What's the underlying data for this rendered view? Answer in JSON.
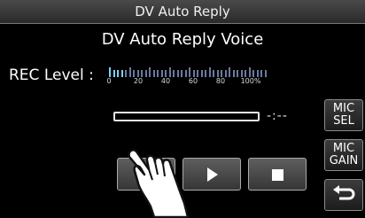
{
  "window": {
    "title": "DV Auto Reply"
  },
  "main": {
    "heading": "DV Auto Reply Voice",
    "rec_level_label": "REC Level :",
    "meter": {
      "scale_labels": [
        "0",
        "20",
        "40",
        "60",
        "80",
        "100%"
      ],
      "level_fraction": 0.1
    },
    "time_readout": "-:--",
    "playback_progress": 0
  },
  "side_buttons": {
    "mic_sel": {
      "line1": "MIC",
      "line2": "SEL"
    },
    "mic_gain": {
      "line1": "MIC",
      "line2": "GAIN"
    },
    "back_icon": "return-arrow-icon"
  },
  "controls": {
    "record_icon": "record-icon",
    "play_icon": "play-icon",
    "stop_icon": "stop-icon"
  },
  "colors": {
    "record": "#ff2a1a",
    "meter_active": "#7fd0ff",
    "background": "#000000"
  }
}
